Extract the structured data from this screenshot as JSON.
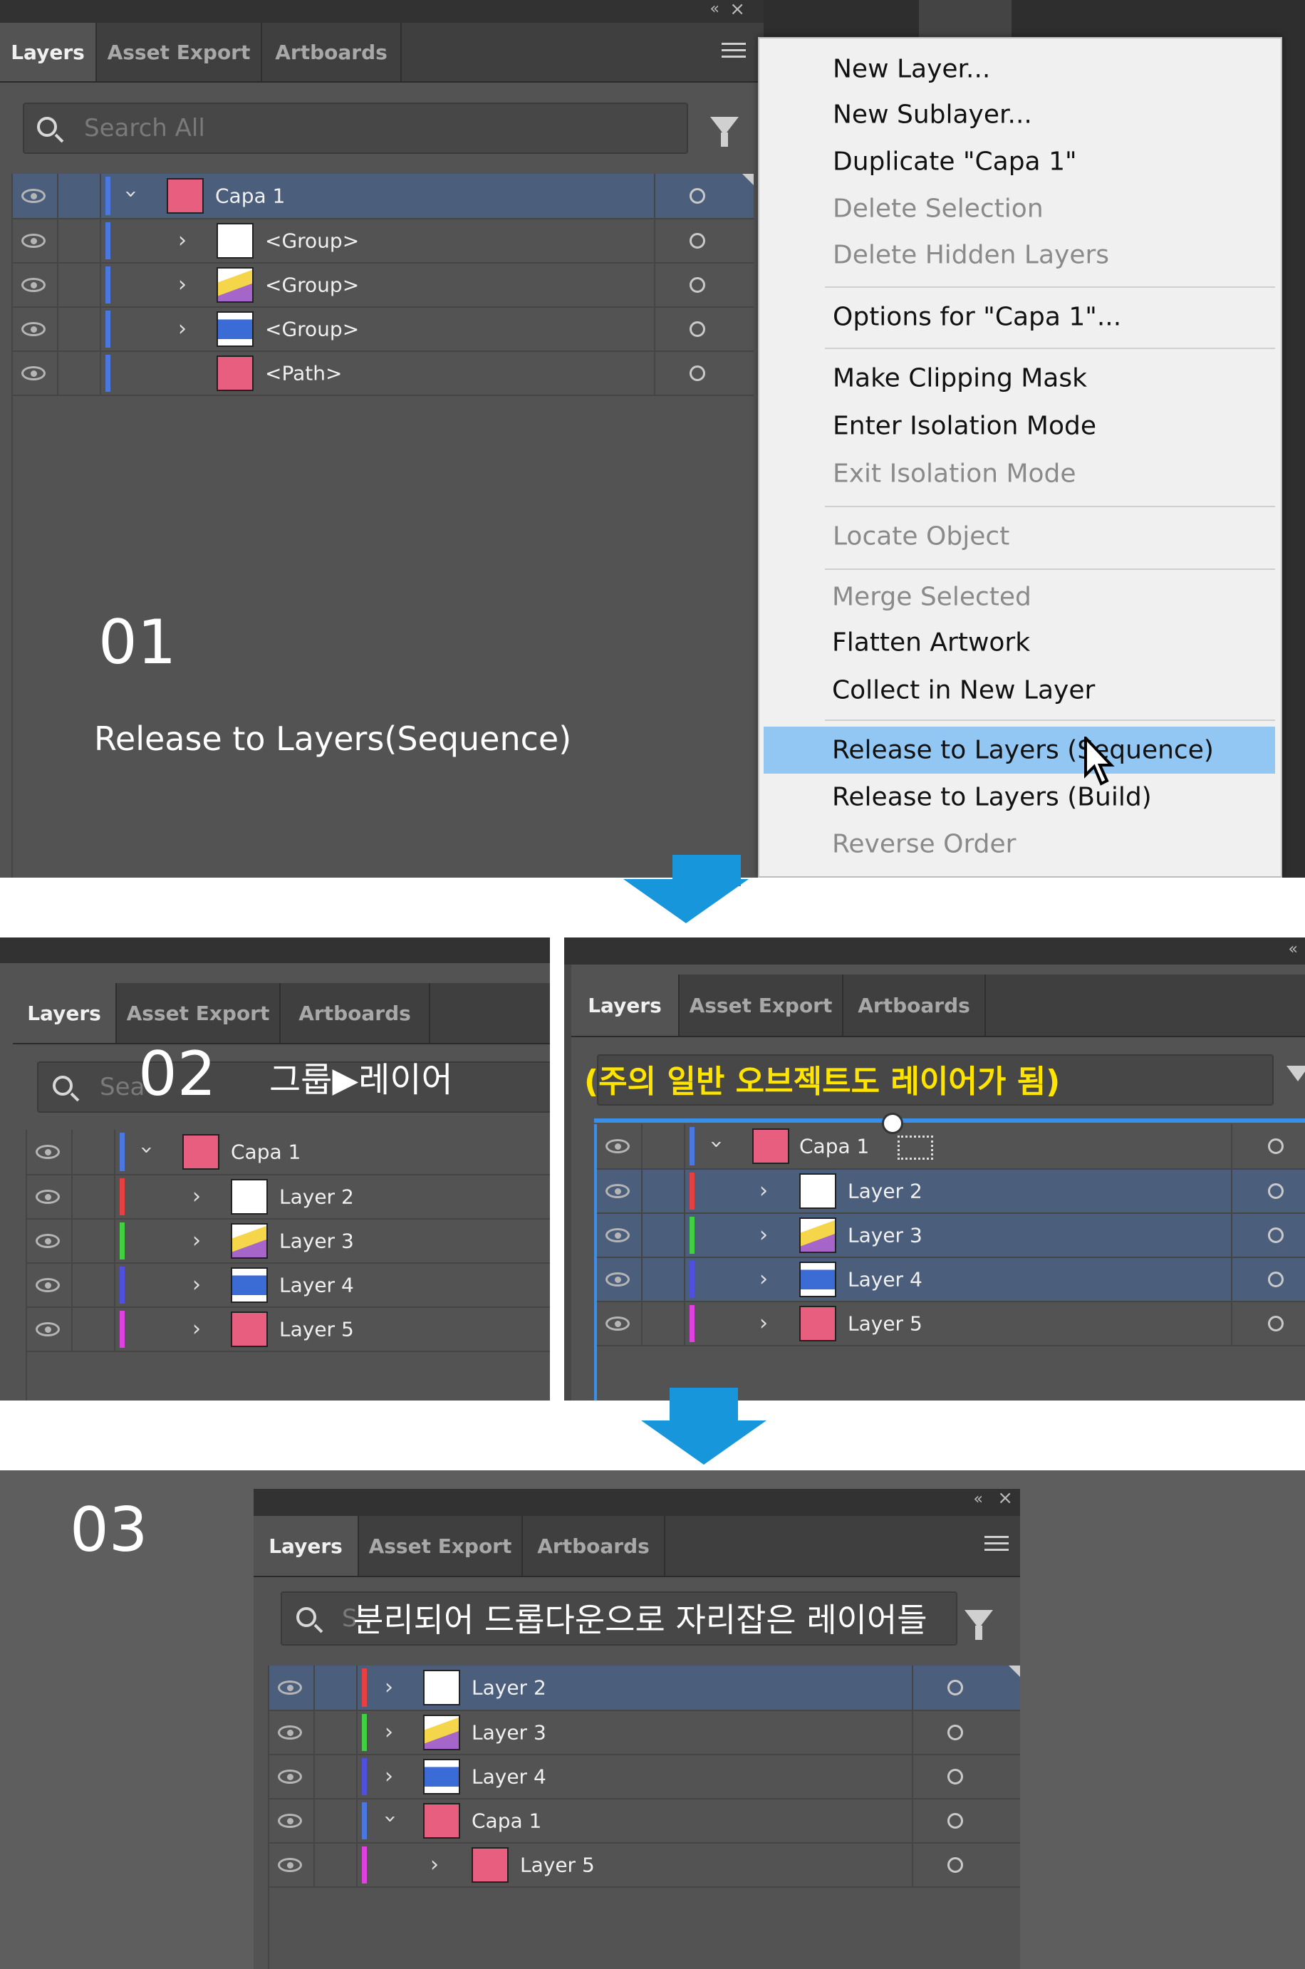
{
  "tabs": {
    "layers": "Layers",
    "asset_export": "Asset Export",
    "artboards": "Artboards"
  },
  "search_placeholder": "Search All",
  "search_partial_1": "Sea",
  "search_partial_3": "S",
  "step1": {
    "number": "01",
    "caption": "Release to Layers(Sequence)"
  },
  "step2": {
    "number": "02",
    "caption": "그룹▶레이어"
  },
  "step2b": {
    "note": "(주의 일반 오브젝트도 레이어가 됨)"
  },
  "step3": {
    "number": "03",
    "caption": "분리되어 드롭다운으로 자리잡은 레이어들"
  },
  "panel1_rows": [
    {
      "label": "Capa 1"
    },
    {
      "label": "<Group>"
    },
    {
      "label": "<Group>"
    },
    {
      "label": "<Group>"
    },
    {
      "label": "<Path>"
    }
  ],
  "panel2_rows": [
    {
      "label": "Capa 1"
    },
    {
      "label": "Layer 2"
    },
    {
      "label": "Layer 3"
    },
    {
      "label": "Layer 4"
    },
    {
      "label": "Layer 5"
    }
  ],
  "panel3_rows": [
    {
      "label": "Layer 2"
    },
    {
      "label": "Layer 3"
    },
    {
      "label": "Layer 4"
    },
    {
      "label": "Capa 1"
    },
    {
      "label": "Layer 5"
    }
  ],
  "menu": [
    {
      "label": "New Layer...",
      "disabled": false
    },
    {
      "label": "New Sublayer...",
      "disabled": false
    },
    {
      "label": "Duplicate \"Capa 1\"",
      "disabled": false
    },
    {
      "label": "Delete Selection",
      "disabled": true
    },
    {
      "label": "Delete Hidden Layers",
      "disabled": true
    },
    {
      "label": "Options for \"Capa 1\"...",
      "disabled": false
    },
    {
      "label": "Make Clipping Mask",
      "disabled": false
    },
    {
      "label": "Enter Isolation Mode",
      "disabled": false
    },
    {
      "label": "Exit Isolation Mode",
      "disabled": true
    },
    {
      "label": "Locate Object",
      "disabled": true
    },
    {
      "label": "Merge Selected",
      "disabled": true
    },
    {
      "label": "Flatten Artwork",
      "disabled": false
    },
    {
      "label": "Collect in New Layer",
      "disabled": false
    },
    {
      "label": "Release to Layers (Sequence)",
      "disabled": false
    },
    {
      "label": "Release to Layers (Build)",
      "disabled": false
    },
    {
      "label": "Reverse Order",
      "disabled": true
    }
  ],
  "colors": {
    "panel_bg": "#535353",
    "selected_row": "#4b5f7c",
    "menu_highlight": "#92c6f3",
    "arrow": "#1796dc",
    "note_yellow": "#ffe400",
    "layer_red": "#e84040",
    "layer_green": "#40d040",
    "layer_blue": "#4f4fe0",
    "layer_magenta": "#e040e0",
    "layer_lightblue": "#4a78e0"
  }
}
